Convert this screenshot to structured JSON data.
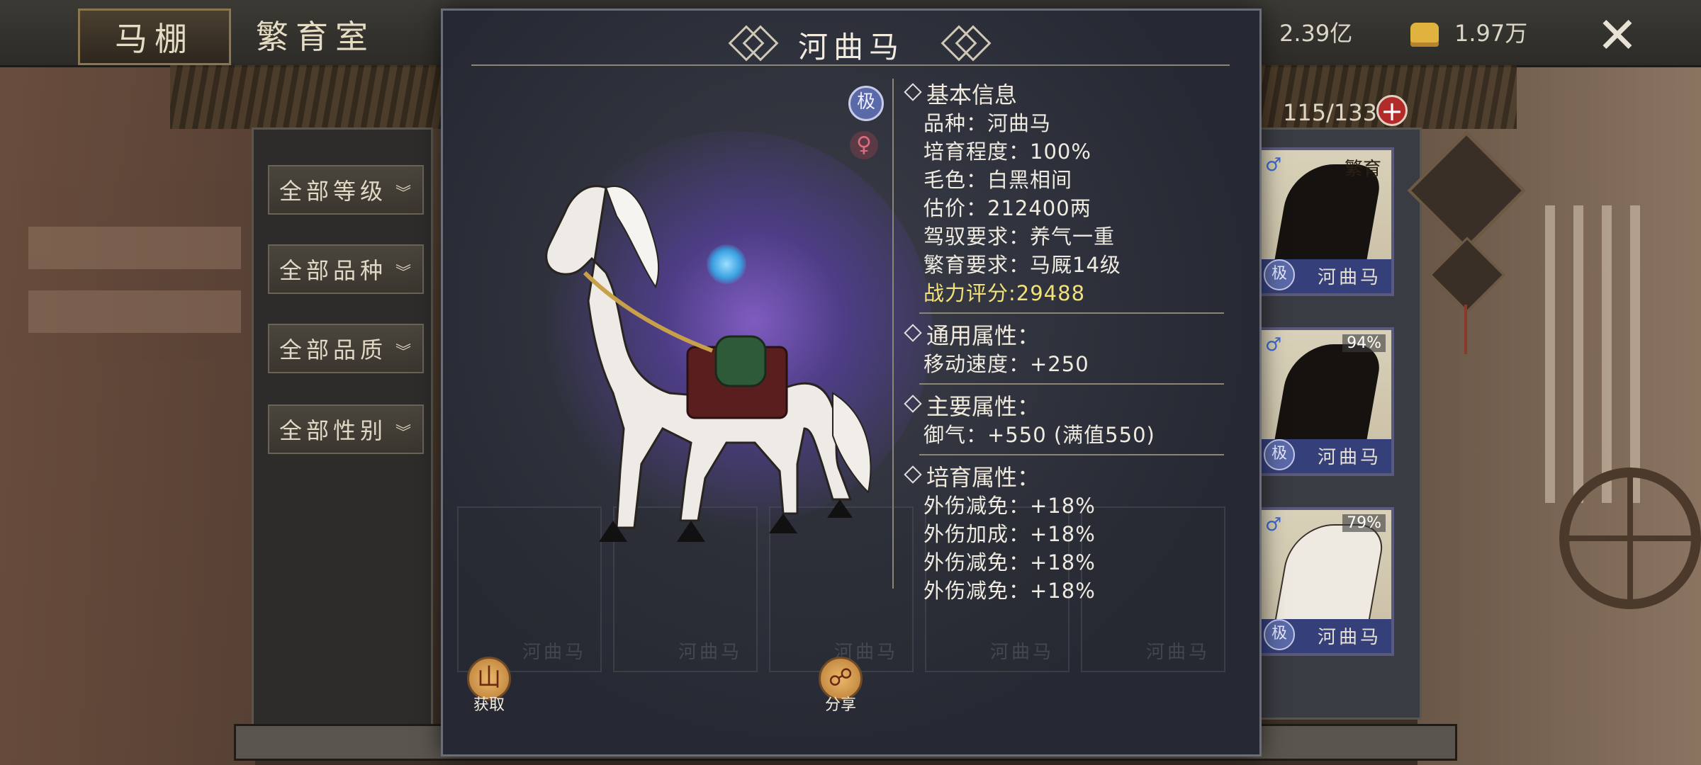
{
  "top_tabs": [
    {
      "label": "马棚",
      "active": true
    },
    {
      "label": "繁育室",
      "active": false
    }
  ],
  "currency": {
    "silver": "2.39亿",
    "gold": "1.97万"
  },
  "stable_count": "115/133",
  "filters": [
    "全部等级",
    "全部品种",
    "全部品质",
    "全部性别"
  ],
  "horse_list": [
    {
      "name": "河曲马",
      "badge": "繁育",
      "coat": "black",
      "gender": "♂",
      "rank": "极"
    },
    {
      "name": "河曲马",
      "badge": "94%",
      "coat": "black",
      "gender": "♂",
      "rank": "极"
    },
    {
      "name": "河曲马",
      "badge": "79%",
      "coat": "white",
      "gender": "♂",
      "rank": "极"
    }
  ],
  "popup": {
    "title": "河曲马",
    "rank_icon": "极",
    "gender_icon": "♀",
    "basic": {
      "heading": "基本信息",
      "rows": [
        "品种：河曲马",
        "培育程度：100%",
        "毛色：白黑相间",
        "估价：212400两",
        "驾驭要求：养气一重",
        "繁育要求：马厩14级"
      ],
      "power": "战力评分:29488"
    },
    "general": {
      "heading": "通用属性：",
      "rows": [
        "移动速度：+250"
      ]
    },
    "main": {
      "heading": "主要属性：",
      "rows": [
        "御气：+550 (满值550)"
      ]
    },
    "breeding": {
      "heading": "培育属性：",
      "rows": [
        "外伤减免：+18%",
        "外伤加成：+18%",
        "外伤减免：+18%",
        "外伤减免：+18%"
      ]
    },
    "actions": [
      {
        "label": "获取",
        "icon": "mountain-icon"
      },
      {
        "label": "分享",
        "icon": "share-icon"
      }
    ]
  },
  "background_cards_name": "河曲马",
  "colors": {
    "accent_gold": "#f2e07a",
    "rank_blue": "#5a6aa8",
    "card_foot": "#35407a",
    "plus_red": "#b32a2a"
  }
}
